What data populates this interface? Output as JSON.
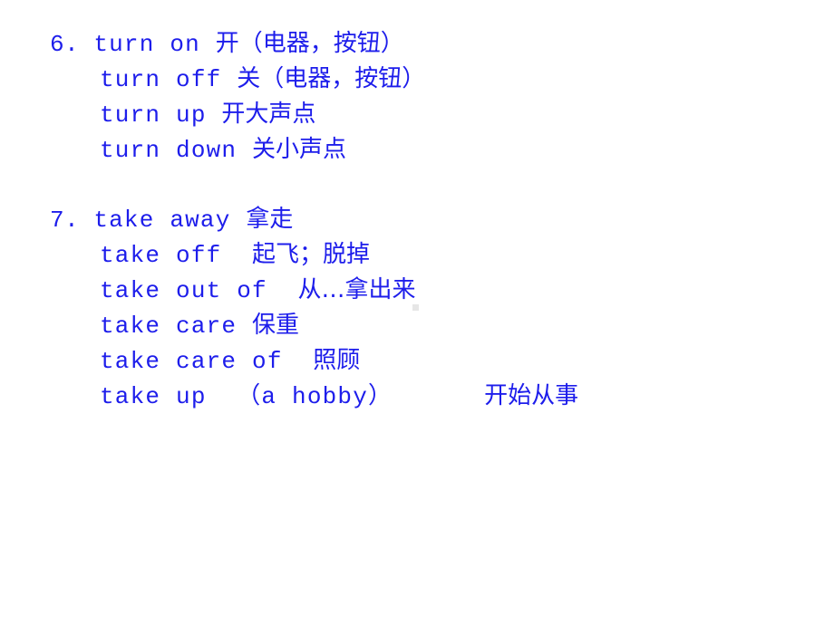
{
  "slide": {
    "background_color": "#ffffff",
    "text_color": "#1d1deb",
    "artifact_color": "#e6e6e6",
    "groups": [
      {
        "number": "6.",
        "entries": [
          {
            "english": "turn on",
            "chinese": "开（电器，按钮）"
          },
          {
            "english": "turn off",
            "chinese": "关（电器，按钮）"
          },
          {
            "english": "turn up",
            "chinese": "开大声点"
          },
          {
            "english": "turn down",
            "chinese": "关小声点"
          }
        ]
      },
      {
        "number": "7.",
        "entries": [
          {
            "english": "take away",
            "chinese": "拿走"
          },
          {
            "english": "take off",
            "chinese": "起飞；脱掉"
          },
          {
            "english": "take out of",
            "chinese": "从…拿出来"
          },
          {
            "english": "take care",
            "chinese": "保重"
          },
          {
            "english": "take care of",
            "chinese": "照顾"
          },
          {
            "english": "take up （a hobby）",
            "chinese": "开始从事"
          }
        ]
      }
    ],
    "lines": [
      {
        "num": "6. ",
        "en": "turn on ",
        "gap": "",
        "cn": "开（电器，按钮）"
      },
      {
        "num": "",
        "en": "turn off ",
        "gap": "",
        "cn": "关（电器，按钮）"
      },
      {
        "num": "",
        "en": "turn up ",
        "gap": "",
        "cn": "开大声点"
      },
      {
        "num": "",
        "en": "turn down ",
        "gap": "",
        "cn": "关小声点"
      },
      {
        "num": "7. ",
        "en": "take away ",
        "gap": "",
        "cn": "拿走"
      },
      {
        "num": "",
        "en": "take off ",
        "gap": " ",
        "cn": "起飞；脱掉"
      },
      {
        "num": "",
        "en": "take out of ",
        "gap": " ",
        "cn": "从…拿出来"
      },
      {
        "num": "",
        "en": "take care ",
        "gap": "",
        "cn": "保重"
      },
      {
        "num": "",
        "en": "take care of ",
        "gap": " ",
        "cn": "照顾"
      },
      {
        "num": "",
        "en": "take up  （a hobby）",
        "gap": "      ",
        "cn": "开始从事"
      }
    ]
  }
}
